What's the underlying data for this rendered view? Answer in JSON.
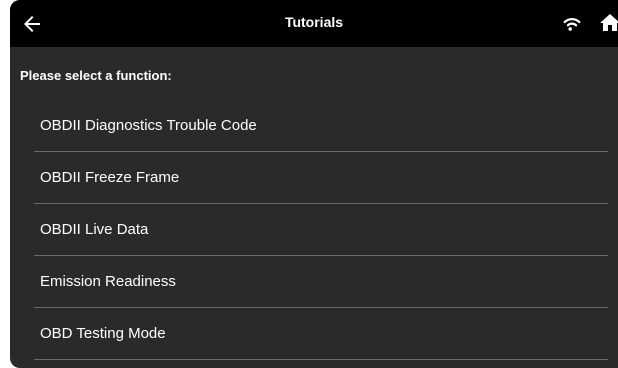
{
  "header": {
    "title": "Tutorials",
    "back_icon": "back-arrow-icon",
    "wifi_icon": "wifi-icon",
    "home_icon": "home-icon"
  },
  "prompt": "Please select a function:",
  "menu": {
    "items": [
      {
        "label": "OBDII Diagnostics Trouble Code"
      },
      {
        "label": "OBDII Freeze Frame"
      },
      {
        "label": "OBDII Live Data"
      },
      {
        "label": "Emission Readiness"
      },
      {
        "label": "OBD Testing Mode"
      }
    ]
  },
  "colors": {
    "background": "#2a2a2a",
    "topbar": "#000000",
    "text": "#ffffff",
    "divider": "#6a6a6a"
  }
}
